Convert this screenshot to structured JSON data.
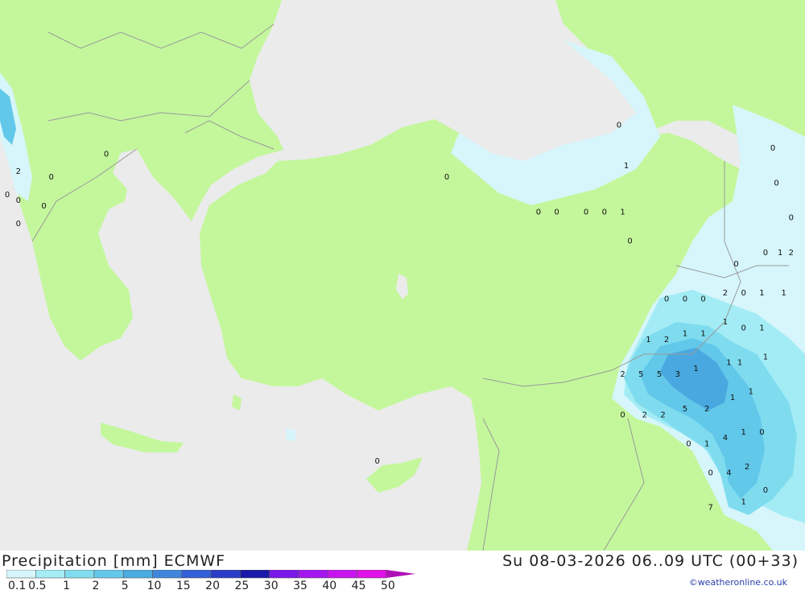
{
  "title": "Precipitation [mm] ECMWF",
  "datetime": "Su 08-03-2026 06..09 UTC (00+33)",
  "credit": "©weatheronline.co.uk",
  "colors": {
    "sea": "#ebebeb",
    "land": "#c4f79c",
    "border": "#9a9a9a",
    "precip_0": "#d6f6fb",
    "precip_05": "#a3ecf5",
    "precip_1": "#7fdcef",
    "precip_2": "#62c8ea",
    "precip_5": "#4aa8e0"
  },
  "legend": {
    "ticks": [
      "0.1",
      "0.5",
      "1",
      "2",
      "5",
      "10",
      "15",
      "20",
      "25",
      "30",
      "35",
      "40",
      "45",
      "50"
    ],
    "colors": [
      "#d6f6fb",
      "#a6ecf5",
      "#82dcef",
      "#64c8ea",
      "#4aace0",
      "#4087dc",
      "#3460d8",
      "#2a3cc8",
      "#1a1aa8",
      "#7a18e8",
      "#a416f0",
      "#c814f0",
      "#e010e8",
      "#b010b8"
    ]
  },
  "point_values": [
    {
      "v": "0",
      "lon": 22.3,
      "lat": 41.6
    },
    {
      "v": "2",
      "lon": 19.9,
      "lat": 41.3
    },
    {
      "v": "0",
      "lon": 20.8,
      "lat": 41.2
    },
    {
      "v": "0",
      "lon": 19.6,
      "lat": 40.9
    },
    {
      "v": "0",
      "lon": 19.9,
      "lat": 40.8
    },
    {
      "v": "0",
      "lon": 20.6,
      "lat": 40.7
    },
    {
      "v": "0",
      "lon": 19.9,
      "lat": 40.4
    },
    {
      "v": "0",
      "lon": 36.3,
      "lat": 42.1
    },
    {
      "v": "1",
      "lon": 36.5,
      "lat": 41.4
    },
    {
      "v": "0",
      "lon": 31.6,
      "lat": 41.2
    },
    {
      "v": "0",
      "lon": 34.1,
      "lat": 40.6
    },
    {
      "v": "0",
      "lon": 34.6,
      "lat": 40.6
    },
    {
      "v": "0",
      "lon": 35.4,
      "lat": 40.6
    },
    {
      "v": "0",
      "lon": 35.9,
      "lat": 40.6
    },
    {
      "v": "1",
      "lon": 36.4,
      "lat": 40.6
    },
    {
      "v": "0",
      "lon": 36.6,
      "lat": 40.1
    },
    {
      "v": "0",
      "lon": 40.5,
      "lat": 41.7
    },
    {
      "v": "0",
      "lon": 40.6,
      "lat": 41.1
    },
    {
      "v": "0",
      "lon": 41.0,
      "lat": 40.5
    },
    {
      "v": "0",
      "lon": 39.5,
      "lat": 39.7
    },
    {
      "v": "0",
      "lon": 40.3,
      "lat": 39.9
    },
    {
      "v": "1",
      "lon": 40.7,
      "lat": 39.9
    },
    {
      "v": "2",
      "lon": 41.0,
      "lat": 39.9
    },
    {
      "v": "0",
      "lon": 37.6,
      "lat": 39.1
    },
    {
      "v": "0",
      "lon": 38.1,
      "lat": 39.1
    },
    {
      "v": "0",
      "lon": 38.6,
      "lat": 39.1
    },
    {
      "v": "2",
      "lon": 39.2,
      "lat": 39.2
    },
    {
      "v": "0",
      "lon": 39.7,
      "lat": 39.2
    },
    {
      "v": "1",
      "lon": 40.2,
      "lat": 39.2
    },
    {
      "v": "1",
      "lon": 40.8,
      "lat": 39.2
    },
    {
      "v": "1",
      "lon": 39.2,
      "lat": 38.7
    },
    {
      "v": "0",
      "lon": 39.7,
      "lat": 38.6
    },
    {
      "v": "1",
      "lon": 40.2,
      "lat": 38.6
    },
    {
      "v": "1",
      "lon": 37.1,
      "lat": 38.4
    },
    {
      "v": "2",
      "lon": 37.6,
      "lat": 38.4
    },
    {
      "v": "1",
      "lon": 38.1,
      "lat": 38.5
    },
    {
      "v": "1",
      "lon": 38.6,
      "lat": 38.5
    },
    {
      "v": "1",
      "lon": 39.3,
      "lat": 38.0
    },
    {
      "v": "1",
      "lon": 39.6,
      "lat": 38.0
    },
    {
      "v": "1",
      "lon": 40.3,
      "lat": 38.1
    },
    {
      "v": "2",
      "lon": 36.4,
      "lat": 37.8
    },
    {
      "v": "5",
      "lon": 36.9,
      "lat": 37.8
    },
    {
      "v": "5",
      "lon": 37.4,
      "lat": 37.8
    },
    {
      "v": "3",
      "lon": 37.9,
      "lat": 37.8
    },
    {
      "v": "1",
      "lon": 38.4,
      "lat": 37.9
    },
    {
      "v": "1",
      "lon": 39.9,
      "lat": 37.5
    },
    {
      "v": "1",
      "lon": 39.4,
      "lat": 37.4
    },
    {
      "v": "2",
      "lon": 38.7,
      "lat": 37.2
    },
    {
      "v": "5",
      "lon": 38.1,
      "lat": 37.2
    },
    {
      "v": "2",
      "lon": 37.5,
      "lat": 37.1
    },
    {
      "v": "2",
      "lon": 37.0,
      "lat": 37.1
    },
    {
      "v": "0",
      "lon": 36.4,
      "lat": 37.1
    },
    {
      "v": "0",
      "lon": 38.2,
      "lat": 36.6
    },
    {
      "v": "1",
      "lon": 38.7,
      "lat": 36.6
    },
    {
      "v": "4",
      "lon": 39.2,
      "lat": 36.7
    },
    {
      "v": "1",
      "lon": 39.7,
      "lat": 36.8
    },
    {
      "v": "0",
      "lon": 40.2,
      "lat": 36.8
    },
    {
      "v": "0",
      "lon": 38.8,
      "lat": 36.1
    },
    {
      "v": "4",
      "lon": 39.3,
      "lat": 36.1
    },
    {
      "v": "2",
      "lon": 39.8,
      "lat": 36.2
    },
    {
      "v": "0",
      "lon": 40.3,
      "lat": 35.8
    },
    {
      "v": "1",
      "lon": 39.7,
      "lat": 35.6
    },
    {
      "v": "7",
      "lon": 38.8,
      "lat": 35.5
    },
    {
      "v": "0",
      "lon": 29.7,
      "lat": 36.3
    }
  ]
}
